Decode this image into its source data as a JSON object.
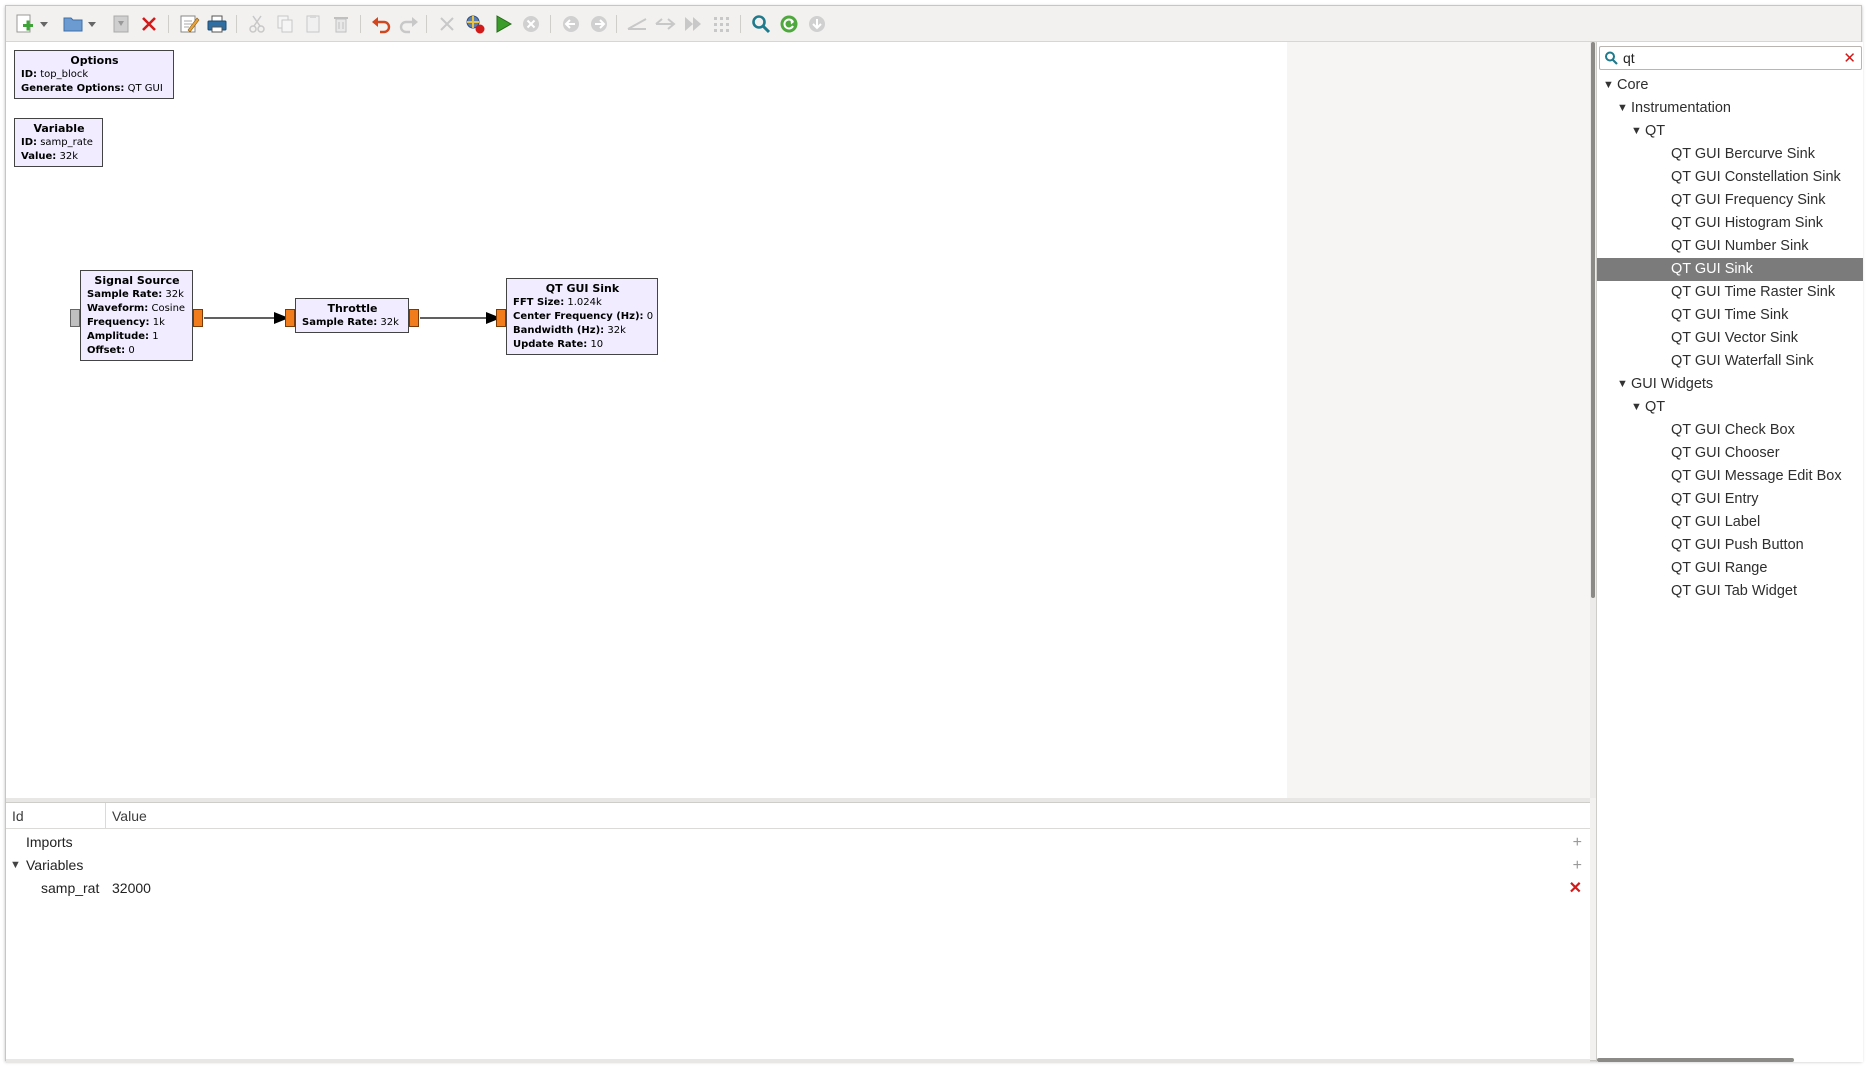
{
  "toolbar": {
    "icons": [
      "new-icon",
      "dropdown-arrow-icon",
      "open-icon",
      "dropdown-arrow-icon",
      "save-icon",
      "close-icon",
      "properties-icon",
      "print-icon",
      "cut-icon",
      "copy-icon",
      "paste-icon",
      "delete-icon",
      "undo-icon",
      "redo-icon",
      "disable-icon",
      "generate-icon",
      "execute-icon",
      "kill-icon",
      "rotate-left-icon",
      "rotate-right-icon",
      "bypass-icon",
      "enable-icon",
      "disable-block-icon",
      "grid-icon",
      "find-icon",
      "reload-icon",
      "download-icon"
    ]
  },
  "colors": {
    "block_fill": "#f1ecff",
    "port": "#f07c1b",
    "selected_row": "#7b7b7b",
    "remove": "#d11a1a",
    "execute": "#3c9c2b"
  },
  "canvas": {
    "options_block": {
      "title": "Options",
      "params": [
        {
          "key": "ID:",
          "value": "top_block"
        },
        {
          "key": "Generate Options:",
          "value": "QT GUI"
        }
      ]
    },
    "variable_block": {
      "title": "Variable",
      "params": [
        {
          "key": "ID:",
          "value": "samp_rate"
        },
        {
          "key": "Value:",
          "value": "32k"
        }
      ]
    },
    "signal_source_block": {
      "title": "Signal Source",
      "params": [
        {
          "key": "Sample Rate:",
          "value": "32k"
        },
        {
          "key": "Waveform:",
          "value": "Cosine"
        },
        {
          "key": "Frequency:",
          "value": "1k"
        },
        {
          "key": "Amplitude:",
          "value": "1"
        },
        {
          "key": "Offset:",
          "value": "0"
        }
      ]
    },
    "throttle_block": {
      "title": "Throttle",
      "params": [
        {
          "key": "Sample Rate:",
          "value": "32k"
        }
      ]
    },
    "qt_gui_sink_block": {
      "title": "QT GUI Sink",
      "params": [
        {
          "key": "FFT Size:",
          "value": "1.024k"
        },
        {
          "key": "Center Frequency (Hz):",
          "value": "0"
        },
        {
          "key": "Bandwidth (Hz):",
          "value": "32k"
        },
        {
          "key": "Update Rate:",
          "value": "10"
        }
      ]
    }
  },
  "variables_panel": {
    "col_id": "Id",
    "col_value": "Value",
    "imports_label": "Imports",
    "variables_label": "Variables",
    "rows": [
      {
        "id": "samp_rat",
        "value": "32000"
      }
    ],
    "expanded_triangle": "▼",
    "add_symbol": "+",
    "remove_symbol": "✕"
  },
  "block_tree": {
    "search_value": "qt",
    "clear_symbol": "✕",
    "expanded_triangle": "▼",
    "items": [
      {
        "label": "Core",
        "level": 0,
        "expandable": true
      },
      {
        "label": "Instrumentation",
        "level": 1,
        "expandable": true
      },
      {
        "label": "QT",
        "level": 2,
        "expandable": true
      },
      {
        "label": "QT GUI Bercurve Sink",
        "level": 3,
        "expandable": false
      },
      {
        "label": "QT GUI Constellation Sink",
        "level": 3,
        "expandable": false
      },
      {
        "label": "QT GUI Frequency Sink",
        "level": 3,
        "expandable": false
      },
      {
        "label": "QT GUI Histogram Sink",
        "level": 3,
        "expandable": false
      },
      {
        "label": "QT GUI Number Sink",
        "level": 3,
        "expandable": false
      },
      {
        "label": "QT GUI Sink",
        "level": 3,
        "expandable": false,
        "selected": true
      },
      {
        "label": "QT GUI Time Raster Sink",
        "level": 3,
        "expandable": false
      },
      {
        "label": "QT GUI Time Sink",
        "level": 3,
        "expandable": false
      },
      {
        "label": "QT GUI Vector Sink",
        "level": 3,
        "expandable": false
      },
      {
        "label": "QT GUI Waterfall Sink",
        "level": 3,
        "expandable": false
      },
      {
        "label": "GUI Widgets",
        "level": 1,
        "expandable": true
      },
      {
        "label": "QT",
        "level": 2,
        "expandable": true
      },
      {
        "label": "QT GUI Check Box",
        "level": 3,
        "expandable": false
      },
      {
        "label": "QT GUI Chooser",
        "level": 3,
        "expandable": false
      },
      {
        "label": "QT GUI Message Edit Box",
        "level": 3,
        "expandable": false
      },
      {
        "label": "QT GUI Entry",
        "level": 3,
        "expandable": false
      },
      {
        "label": "QT GUI Label",
        "level": 3,
        "expandable": false
      },
      {
        "label": "QT GUI Push Button",
        "level": 3,
        "expandable": false
      },
      {
        "label": "QT GUI Range",
        "level": 3,
        "expandable": false
      },
      {
        "label": "QT GUI Tab Widget",
        "level": 3,
        "expandable": false
      }
    ]
  }
}
